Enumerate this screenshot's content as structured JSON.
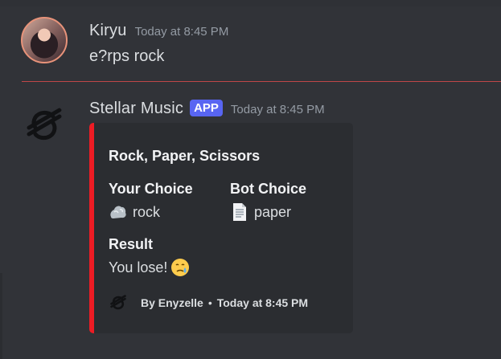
{
  "messages": [
    {
      "author": "Kiryu",
      "timestamp": "Today at 8:45 PM",
      "content": "e?rps rock",
      "avatar": "user-avatar-photo"
    },
    {
      "author": "Stellar Music",
      "badge": "APP",
      "timestamp": "Today at 8:45 PM",
      "avatar": "stellar-logo-icon",
      "embed": {
        "accent_color": "#ed1c24",
        "title": "Rock, Paper, Scissors",
        "fields": [
          {
            "name": "Your Choice",
            "value": "rock",
            "icon": "rock-icon"
          },
          {
            "name": "Bot Choice",
            "value": "paper",
            "icon": "paper-icon"
          },
          {
            "name": "Result",
            "value": "You lose!",
            "icon": "crying-face-icon"
          }
        ],
        "footer": {
          "text": "By Enyzelle",
          "separator": "•",
          "timestamp": "Today at 8:45 PM",
          "icon": "stellar-logo-icon"
        }
      }
    }
  ],
  "colors": {
    "background": "#313338",
    "embed_background": "#2b2d31",
    "app_badge": "#5865f2",
    "divider": "#d84b4b"
  }
}
